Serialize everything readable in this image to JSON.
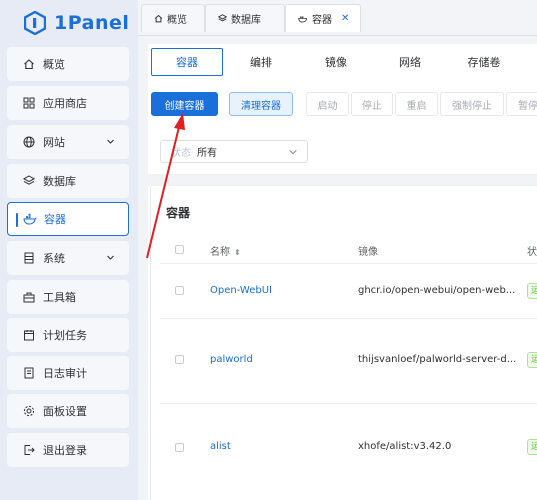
{
  "brand": {
    "name": "1Panel"
  },
  "sidebar": {
    "items": [
      {
        "label": "概览",
        "icon": "home-icon"
      },
      {
        "label": "应用商店",
        "icon": "grid-icon"
      },
      {
        "label": "网站",
        "icon": "globe-icon"
      },
      {
        "label": "数据库",
        "icon": "layers-icon"
      },
      {
        "label": "容器",
        "icon": "docker-icon"
      },
      {
        "label": "系统",
        "icon": "server-icon"
      },
      {
        "label": "工具箱",
        "icon": "toolbox-icon"
      },
      {
        "label": "计划任务",
        "icon": "calendar-icon"
      },
      {
        "label": "日志审计",
        "icon": "log-icon"
      },
      {
        "label": "面板设置",
        "icon": "gear-icon"
      },
      {
        "label": "退出登录",
        "icon": "logout-icon"
      }
    ]
  },
  "tabs": [
    {
      "label": "概览"
    },
    {
      "label": "数据库"
    },
    {
      "label": "容器"
    }
  ],
  "subtabs": [
    "容器",
    "编排",
    "镜像",
    "网络",
    "存储卷"
  ],
  "toolbar": {
    "create": "创建容器",
    "clean": "清理容器",
    "start": "启动",
    "stop": "停止",
    "restart": "重启",
    "kill": "强制停止",
    "pause": "暂停"
  },
  "filter": {
    "label": "状态",
    "value": "所有"
  },
  "card": {
    "title": "容器",
    "columns": {
      "name": "名称",
      "image": "镜像",
      "state": "状"
    },
    "rows": [
      {
        "name": "Open-WebUI",
        "image": "ghcr.io/open-webui/open-web...",
        "state": "运行中"
      },
      {
        "name": "palworld",
        "image": "thijsvanloef/palworld-server-d...",
        "state": "运行中"
      },
      {
        "name": "alist",
        "image": "xhofe/alist:v3.42.0",
        "state": "运行中"
      }
    ]
  },
  "colors": {
    "accent": "#1a6fd8",
    "arrow": "#e02020"
  }
}
